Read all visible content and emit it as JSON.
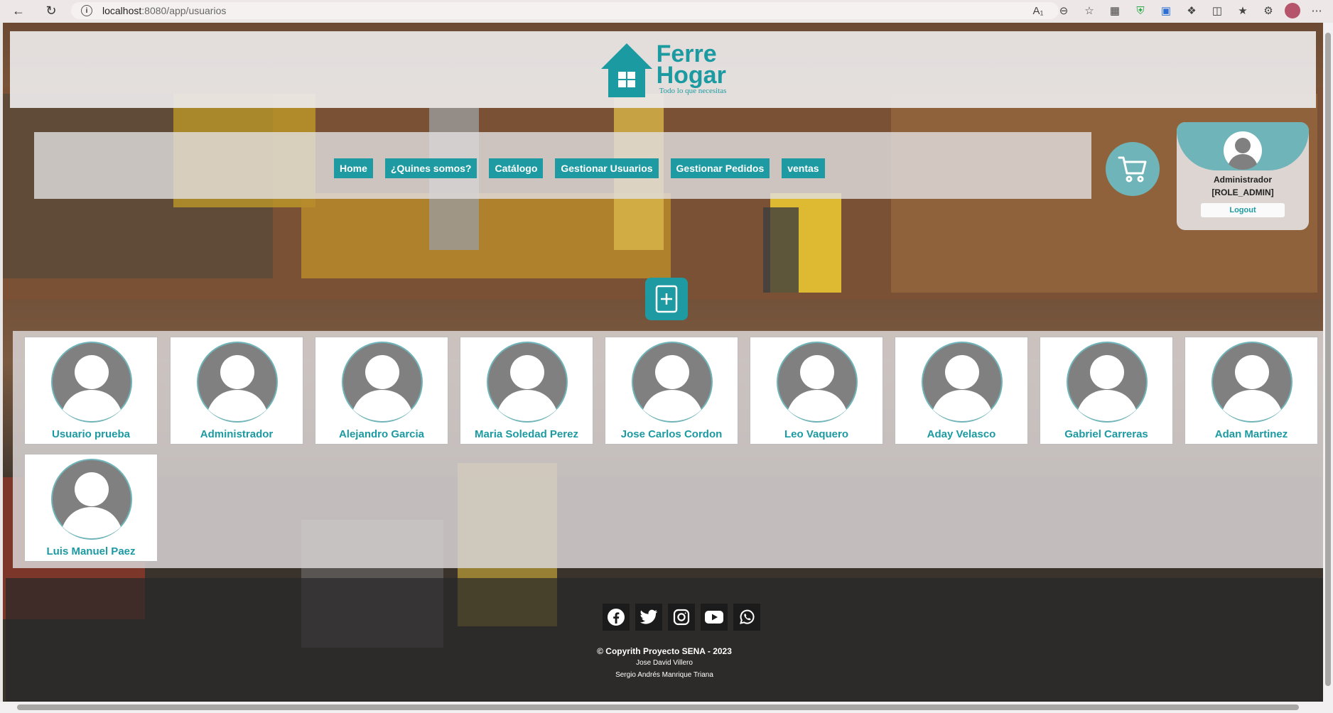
{
  "browser": {
    "url_host": "localhost",
    "url_path": ":8080/app/usuarios"
  },
  "header": {
    "brand_line1": "Ferre",
    "brand_line2": "Hogar",
    "tagline": "Todo lo que necesitas"
  },
  "nav": {
    "items": [
      {
        "label": "Home"
      },
      {
        "label": "¿Quines somos?"
      },
      {
        "label": "Catálogo"
      },
      {
        "label": "Gestionar Usuarios"
      },
      {
        "label": "Gestionar Pedidos"
      },
      {
        "label": "ventas"
      }
    ]
  },
  "account": {
    "name": "Administrador",
    "role": "[ROLE_ADMIN]",
    "logout_label": "Logout"
  },
  "users": [
    {
      "name": "Usuario prueba"
    },
    {
      "name": "Administrador"
    },
    {
      "name": "Alejandro Garcia"
    },
    {
      "name": "Maria Soledad Perez"
    },
    {
      "name": "Jose Carlos Cordon"
    },
    {
      "name": "Leo Vaquero"
    },
    {
      "name": "Aday Velasco"
    },
    {
      "name": "Gabriel Carreras"
    },
    {
      "name": "Adan Martinez"
    },
    {
      "name": "Luis Manuel Paez"
    }
  ],
  "footer": {
    "socials": [
      "facebook-icon",
      "twitter-icon",
      "instagram-icon",
      "youtube-icon",
      "whatsapp-icon"
    ],
    "copyright": "© Copyrith Proyecto SENA - 2023",
    "author1": "Jose David Villero",
    "author2": "Sergio Andrés Manrique Triana"
  },
  "colors": {
    "accent": "#1e9ba2",
    "accent_light": "#6fb4b8",
    "avatar_gray": "#808080"
  }
}
